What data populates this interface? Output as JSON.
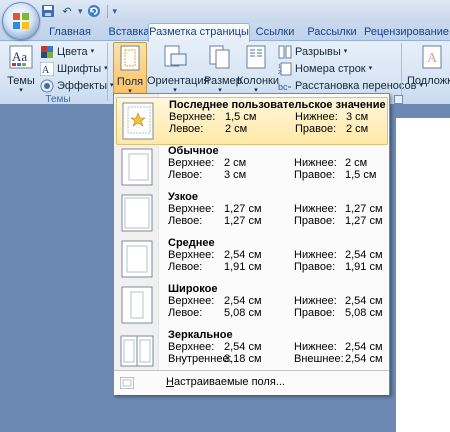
{
  "qat": {
    "save_icon": "save-icon",
    "undo_icon": "undo-icon",
    "redo_icon": "redo-icon",
    "customize_icon": "chevron-down-icon"
  },
  "tabs": [
    {
      "label": "Главная"
    },
    {
      "label": "Вставка"
    },
    {
      "label": "Разметка страницы",
      "active": true
    },
    {
      "label": "Ссылки"
    },
    {
      "label": "Рассылки"
    },
    {
      "label": "Рецензирование"
    }
  ],
  "ribbon": {
    "themes_group": {
      "label": "Темы",
      "themes_button": "Темы",
      "colors": "Цвета",
      "fonts": "Шрифты",
      "effects": "Эффекты"
    },
    "page_setup": {
      "margins": "Поля",
      "orientation": "Ориентация",
      "size": "Размер",
      "columns": "Колонки",
      "breaks": "Разрывы",
      "line_numbers": "Номера строк",
      "hyphenation": "Расстановка переносов"
    },
    "cut_button": "Подложка"
  },
  "margins_menu": {
    "presets": [
      {
        "name": "Последнее пользовательское значение",
        "l1": "Верхнее:",
        "v1": "1,5 см",
        "l2": "Нижнее:",
        "v2": "3 см",
        "l3": "Левое:",
        "v3": "2 см",
        "l4": "Правое:",
        "v4": "2 см"
      },
      {
        "name": "Обычное",
        "l1": "Верхнее:",
        "v1": "2 см",
        "l2": "Нижнее:",
        "v2": "2 см",
        "l3": "Левое:",
        "v3": "3 см",
        "l4": "Правое:",
        "v4": "1,5 см"
      },
      {
        "name": "Узкое",
        "l1": "Верхнее:",
        "v1": "1,27 см",
        "l2": "Нижнее:",
        "v2": "1,27 см",
        "l3": "Левое:",
        "v3": "1,27 см",
        "l4": "Правое:",
        "v4": "1,27 см"
      },
      {
        "name": "Среднее",
        "l1": "Верхнее:",
        "v1": "2,54 см",
        "l2": "Нижнее:",
        "v2": "2,54 см",
        "l3": "Левое:",
        "v3": "1,91 см",
        "l4": "Правое:",
        "v4": "1,91 см"
      },
      {
        "name": "Широкое",
        "l1": "Верхнее:",
        "v1": "2,54 см",
        "l2": "Нижнее:",
        "v2": "2,54 см",
        "l3": "Левое:",
        "v3": "5,08 см",
        "l4": "Правое:",
        "v4": "5,08 см"
      },
      {
        "name": "Зеркальное",
        "l1": "Верхнее:",
        "v1": "2,54 см",
        "l2": "Нижнее:",
        "v2": "2,54 см",
        "l3": "Внутреннее:",
        "v3": "3,18 см",
        "l4": "Внешнее:",
        "v4": "2,54 см"
      }
    ],
    "footer_ul": "Н",
    "footer_rest": "астраиваемые поля..."
  }
}
